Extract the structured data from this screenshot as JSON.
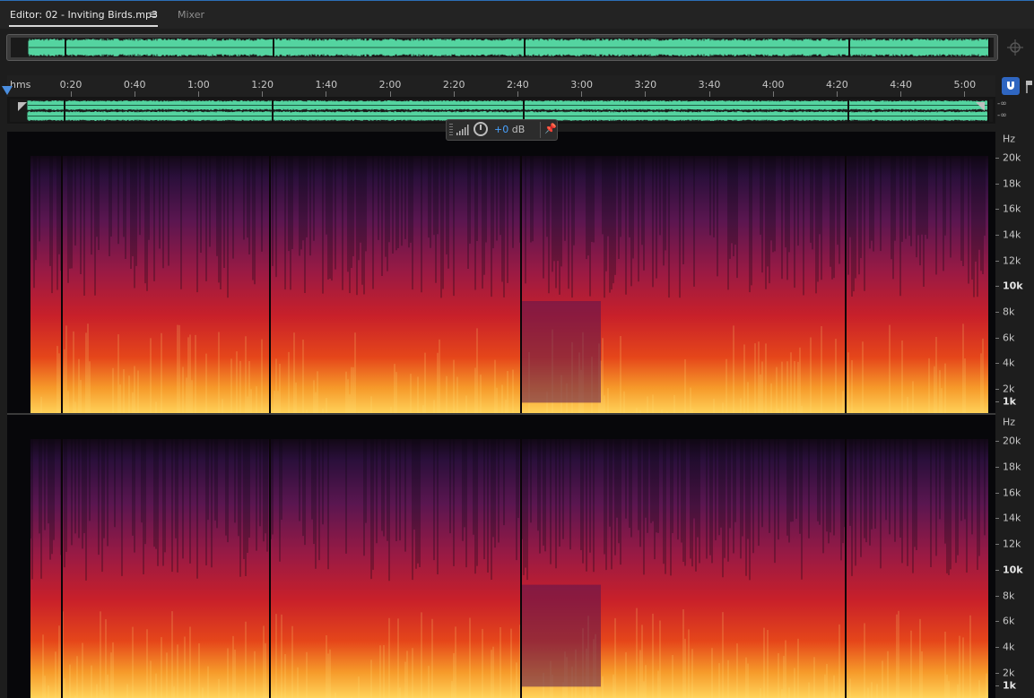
{
  "tabs": {
    "editor_label": "Editor: 02 - Inviting Birds.mp3",
    "mixer_label": "Mixer"
  },
  "colors": {
    "waveform": "#54d4a0",
    "accent": "#2f66c1",
    "spectrogram_low": "#2a0f3a",
    "spectrogram_mid": "#c8202a",
    "spectrogram_high": "#ffd35a"
  },
  "icons": {
    "tab_menu": "hamburger-menu-icon",
    "zoom": "zoom-crosshair-icon",
    "snap": "magnet-snap-icon",
    "marker": "marker-icon",
    "hud_level": "level-bars-icon",
    "hud_knob": "volume-knob-icon",
    "hud_pin": "pin-icon"
  },
  "ruler": {
    "units": "hms",
    "ticks": [
      "0:20",
      "0:40",
      "1:00",
      "1:20",
      "1:40",
      "2:00",
      "2:20",
      "2:40",
      "3:00",
      "3:20",
      "3:40",
      "4:00",
      "4:20",
      "4:40",
      "5:00"
    ]
  },
  "meters": {
    "left": "-∞",
    "right": "-∞"
  },
  "hud": {
    "value": "+0",
    "unit": " dB"
  },
  "freq_axis": {
    "unit": "Hz",
    "labels": [
      "20k",
      "18k",
      "16k",
      "14k",
      "12k",
      "10k",
      "8k",
      "6k",
      "4k",
      "2k",
      "1k"
    ]
  }
}
